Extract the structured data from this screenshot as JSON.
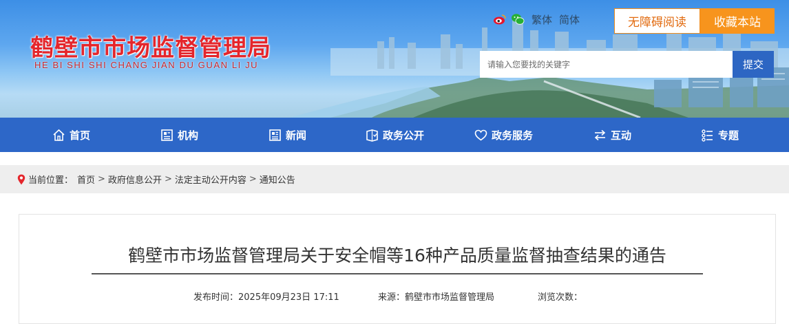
{
  "header": {
    "site_title": "鹤壁市市场监督管理局",
    "site_pinyin": "HE BI SHI SHI CHANG JIAN DU GUAN LI JU",
    "lang_traditional": "繁体",
    "lang_simplified": "简体",
    "accessibility_label": "无障碍阅读",
    "favorite_label": "收藏本站",
    "search_placeholder": "请输入您要找的关键字",
    "search_button_label": "提交"
  },
  "nav": {
    "items": [
      {
        "label": "首页",
        "icon": "home-icon"
      },
      {
        "label": "机构",
        "icon": "org-icon"
      },
      {
        "label": "新闻",
        "icon": "news-icon"
      },
      {
        "label": "政务公开",
        "icon": "open-gov-icon"
      },
      {
        "label": "政务服务",
        "icon": "heart-icon"
      },
      {
        "label": "互动",
        "icon": "exchange-icon"
      },
      {
        "label": "专题",
        "icon": "topic-icon"
      }
    ]
  },
  "breadcrumb": {
    "prefix": "当前位置：",
    "items": [
      "首页",
      "政府信息公开",
      "法定主动公开内容",
      "通知公告"
    ],
    "separator": ">"
  },
  "article": {
    "title": "鹤壁市市场监督管理局关于安全帽等16种产品质量监督抽查结果的通告",
    "publish_time": "发布时间：2025年09月23日 17:11",
    "source": "来源：鹤壁市市场监督管理局",
    "views_label": "浏览次数："
  },
  "colors": {
    "nav_bg": "#2d67c8",
    "title_red": "#e4262c",
    "favorite_orange": "#f7941d",
    "search_button": "#2d66c3"
  }
}
